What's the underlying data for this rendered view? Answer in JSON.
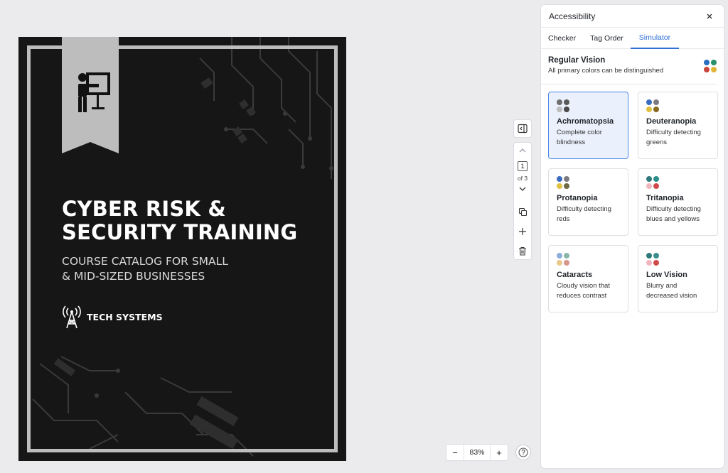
{
  "document": {
    "title_line1": "CYBER RISK &",
    "title_line2": "SECURITY TRAINING",
    "subtitle_line1": "COURSE CATALOG FOR SMALL",
    "subtitle_line2": "& MID-SIZED BUSINESSES",
    "company": "TECH SYSTEMS",
    "icon": "presentation-icon",
    "logo_icon": "radio-tower-icon"
  },
  "toolbar": {
    "page_current": "1",
    "page_of": "of 3",
    "icons": [
      "collapse-panel-icon",
      "chevron-up-icon",
      "chevron-down-icon",
      "duplicate-page-icon",
      "add-page-icon",
      "delete-page-icon"
    ]
  },
  "zoom": {
    "minus": "−",
    "value": "83%",
    "plus": "+"
  },
  "help_icon": "help-icon",
  "panel": {
    "title": "Accessibility",
    "tabs": [
      "Checker",
      "Tag Order",
      "Simulator"
    ],
    "active_tab": "Simulator",
    "regular": {
      "title": "Regular Vision",
      "desc": "All primary colors can be distinguished",
      "dots": [
        "#2a6fbf",
        "#2a8f6a",
        "#c8453a",
        "#e0b53a"
      ]
    },
    "cards": [
      {
        "title": "Achromatopsia",
        "desc": "Complete color blindness",
        "selected": true,
        "dots": [
          "#6e6e6e",
          "#5a5a5a",
          "#bcbcbc",
          "#4a4a4a"
        ]
      },
      {
        "title": "Deuteranopia",
        "desc": "Difficulty detecting greens",
        "selected": false,
        "dots": [
          "#3a6cc0",
          "#7a7a80",
          "#e0c040",
          "#8a6a20"
        ]
      },
      {
        "title": "Protanopia",
        "desc": "Difficulty detecting reds",
        "selected": false,
        "dots": [
          "#3a6cc0",
          "#7a7a80",
          "#e0c040",
          "#6e6a40"
        ]
      },
      {
        "title": "Tritanopia",
        "desc": "Difficulty detecting blues and yellows",
        "selected": false,
        "dots": [
          "#2e7a7a",
          "#2a8f8a",
          "#f0b6c0",
          "#d04a4a"
        ]
      },
      {
        "title": "Cataracts",
        "desc": "Cloudy vision that reduces contrast",
        "selected": false,
        "dots": [
          "#8aaed8",
          "#8ab8a8",
          "#e8c98a",
          "#d8958a"
        ]
      },
      {
        "title": "Low Vision",
        "desc": "Blurry and decreased vision",
        "selected": false,
        "dots": [
          "#2e7a7a",
          "#3a8f8a",
          "#f0b6c0",
          "#d04a4a"
        ]
      }
    ]
  },
  "colors": {
    "accent": "#2f6fd6",
    "selected_bg": "#eaf1fc",
    "page_bg": "#161616"
  }
}
